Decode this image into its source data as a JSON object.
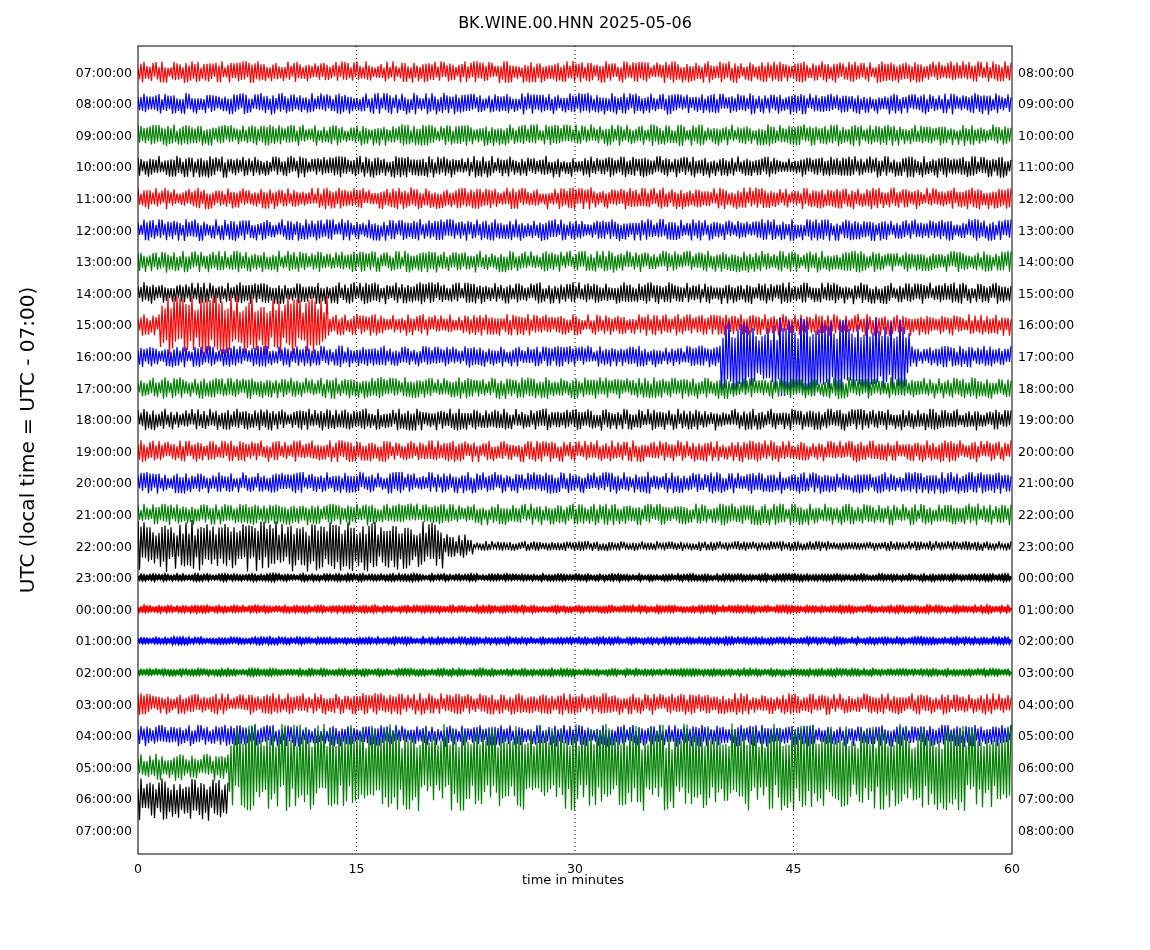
{
  "title": "BK.WINE.00.HNN 2025-05-06",
  "ylabel": "UTC (local time = UTC - 07:00)",
  "xlabel": "time in minutes",
  "xticks": [
    "0",
    "15",
    "30",
    "45",
    "60"
  ],
  "left_labels": [
    "07:00:00",
    "08:00:00",
    "09:00:00",
    "10:00:00",
    "11:00:00",
    "12:00:00",
    "13:00:00",
    "14:00:00",
    "15:00:00",
    "16:00:00",
    "17:00:00",
    "18:00:00",
    "19:00:00",
    "20:00:00",
    "21:00:00",
    "22:00:00",
    "23:00:00",
    "00:00:00",
    "01:00:00",
    "02:00:00",
    "03:00:00",
    "04:00:00",
    "05:00:00",
    "06:00:00",
    "07:00:00"
  ],
  "right_labels": [
    "08:00:00",
    "09:00:00",
    "10:00:00",
    "11:00:00",
    "12:00:00",
    "13:00:00",
    "14:00:00",
    "15:00:00",
    "16:00:00",
    "17:00:00",
    "18:00:00",
    "19:00:00",
    "20:00:00",
    "21:00:00",
    "22:00:00",
    "23:00:00",
    "00:00:00",
    "01:00:00",
    "02:00:00",
    "03:00:00",
    "04:00:00",
    "05:00:00",
    "06:00:00",
    "07:00:00",
    "08:00:00"
  ],
  "traces": [
    {
      "color": "#ff0000"
    },
    {
      "color": "#0000ff"
    },
    {
      "color": "#008000"
    },
    {
      "color": "#000000"
    },
    {
      "color": "#ff0000"
    },
    {
      "color": "#0000ff"
    },
    {
      "color": "#008000"
    },
    {
      "color": "#000000"
    },
    {
      "color": "#ff0000"
    },
    {
      "color": "#0000ff"
    },
    {
      "color": "#008000"
    },
    {
      "color": "#000000"
    },
    {
      "color": "#ff0000"
    },
    {
      "color": "#0000ff"
    },
    {
      "color": "#008000"
    },
    {
      "color": "#000000"
    },
    {
      "color": "#000000"
    },
    {
      "color": "#ff0000"
    },
    {
      "color": "#0000ff"
    },
    {
      "color": "#008000"
    },
    {
      "color": "#ff0000"
    },
    {
      "color": "#0000ff"
    },
    {
      "color": "#008000"
    },
    {
      "color": "#000000"
    }
  ]
}
